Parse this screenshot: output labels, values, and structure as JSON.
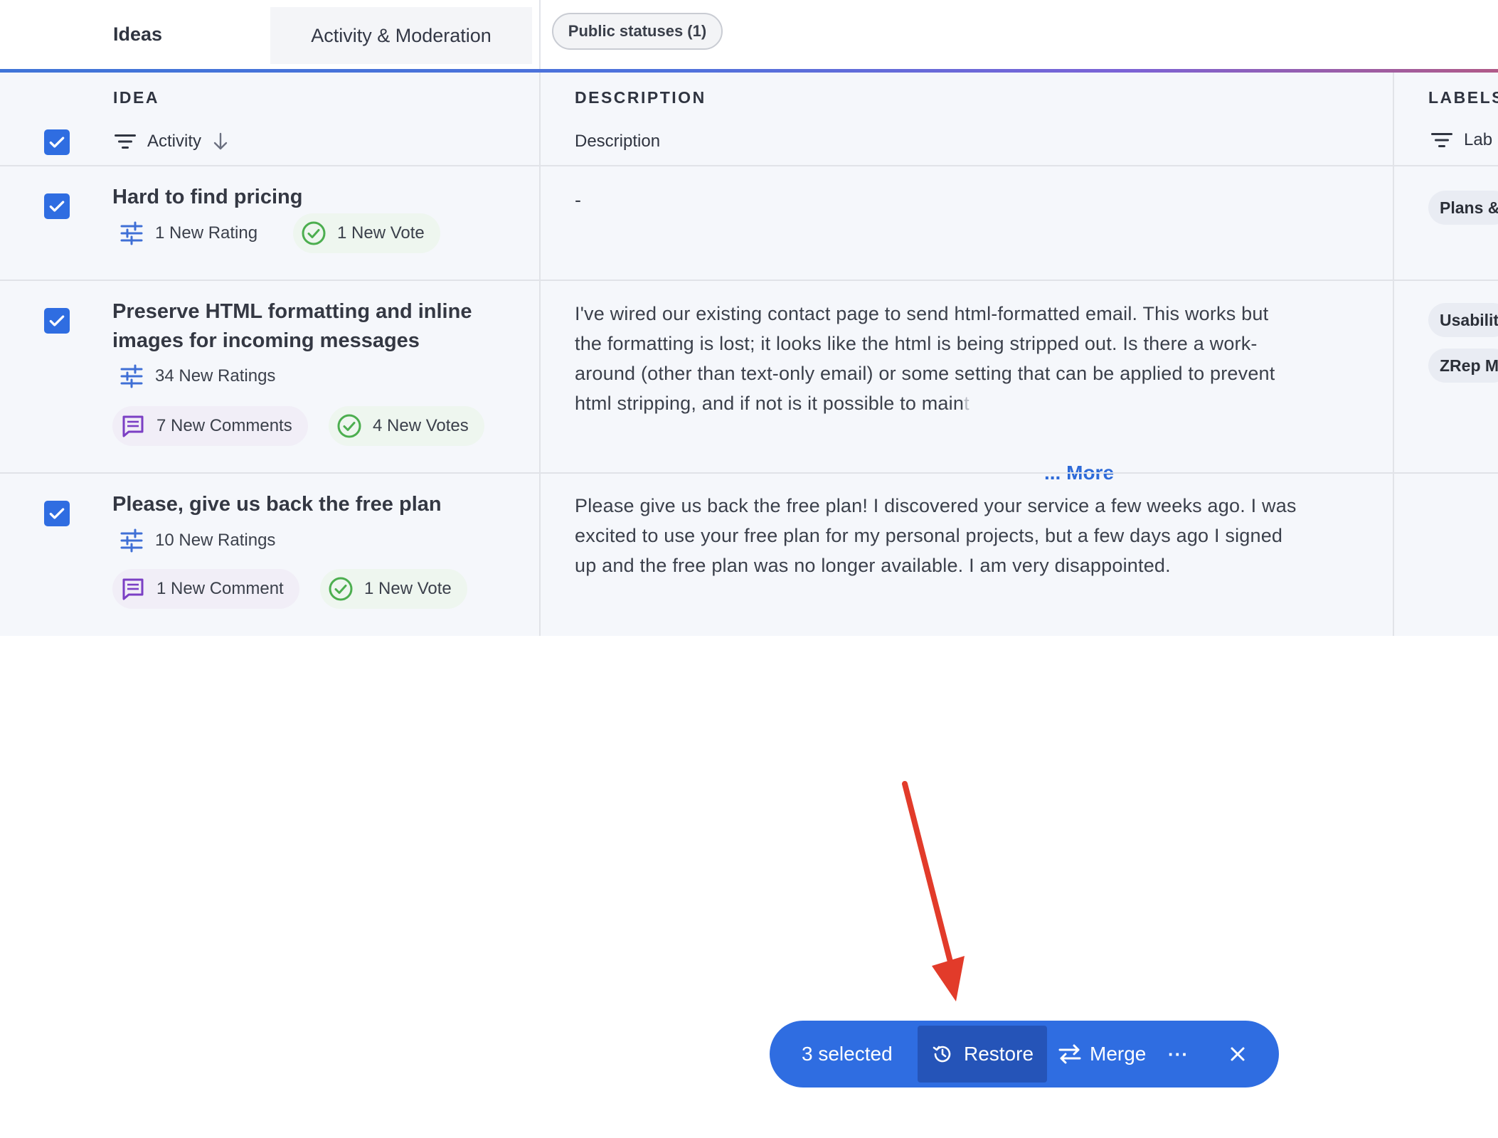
{
  "tabs": {
    "ideas": "Ideas",
    "activity": "Activity & Moderation",
    "public_statuses": "Public statuses (1)"
  },
  "columns": {
    "idea": {
      "title": "IDEA",
      "sort_label": "Activity"
    },
    "description": {
      "title": "DESCRIPTION",
      "sub_label": "Description"
    },
    "labels": {
      "title": "LABELS",
      "sub_label": "Lab"
    }
  },
  "rows": [
    {
      "title": "Hard to find pricing",
      "ratings": "1 New Rating",
      "votes": "1 New Vote",
      "description": "-",
      "labels": [
        "Plans &"
      ]
    },
    {
      "title": "Preserve HTML formatting and inline images for incoming messages",
      "ratings": "34 New Ratings",
      "comments": "7 New Comments",
      "votes": "4 New Votes",
      "description_lines": [
        "I've wired our existing contact page to send html-formatted email. This works but",
        "the formatting is lost; it looks like the html is being stripped out. Is there a work-",
        "around (other than text-only email) or some setting that can be applied to prevent",
        "html stripping, and if not is it possible to main"
      ],
      "description_fade": "t",
      "more_label": "... More",
      "labels": [
        "Usabilit",
        "ZRep M"
      ]
    },
    {
      "title": "Please, give us back the free plan",
      "ratings": "10 New Ratings",
      "comments": "1 New Comment",
      "votes": "1 New Vote",
      "description_lines": [
        "Please give us back the free plan! I discovered your service a few weeks ago. I was",
        "excited to use your free plan for my personal projects, but a few days ago I signed",
        "up and the free plan was no longer available. I am very disappointed."
      ]
    }
  ],
  "action_bar": {
    "selected": "3 selected",
    "restore": "Restore",
    "merge": "Merge",
    "more": "···"
  },
  "colors": {
    "accent": "#2f6de1",
    "restore_bg": "#2554b8",
    "arrow": "#e23b2a",
    "vote_green": "#4cae4f",
    "comment_purple": "#7b3fc4",
    "rating_blue": "#3f6fd6"
  }
}
